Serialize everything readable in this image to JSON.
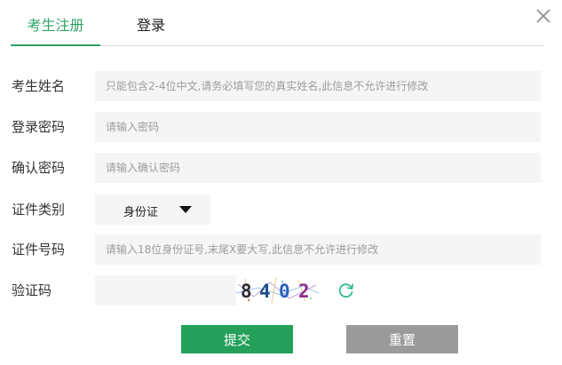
{
  "tabs": {
    "register": "考生注册",
    "login": "登录"
  },
  "form": {
    "name_label": "考生姓名",
    "name_placeholder": "只能包含2-4位中文,请务必填写您的真实姓名,此信息不允许进行修改",
    "password_label": "登录密码",
    "password_placeholder": "请输入密码",
    "confirm_label": "确认密码",
    "confirm_placeholder": "请输入确认密码",
    "idtype_label": "证件类别",
    "idtype_value": "身份证",
    "idnum_label": "证件号码",
    "idnum_placeholder": "请输入18位身份证号,末尾X要大写,此信息不允许进行修改",
    "captcha_label": "验证码",
    "captcha_text": [
      "8",
      "4",
      "0",
      "2"
    ]
  },
  "buttons": {
    "submit": "提交",
    "reset": "重置"
  },
  "colors": {
    "accent": "#2ea264",
    "submit_bg": "#24a05b",
    "reset_bg": "#9a9a9a",
    "field_bg": "#f5f5f5",
    "refresh_icon": "#2bb98a"
  },
  "icons": {
    "close": "close-icon",
    "dropdown": "triangle-down-icon",
    "refresh": "refresh-icon"
  }
}
